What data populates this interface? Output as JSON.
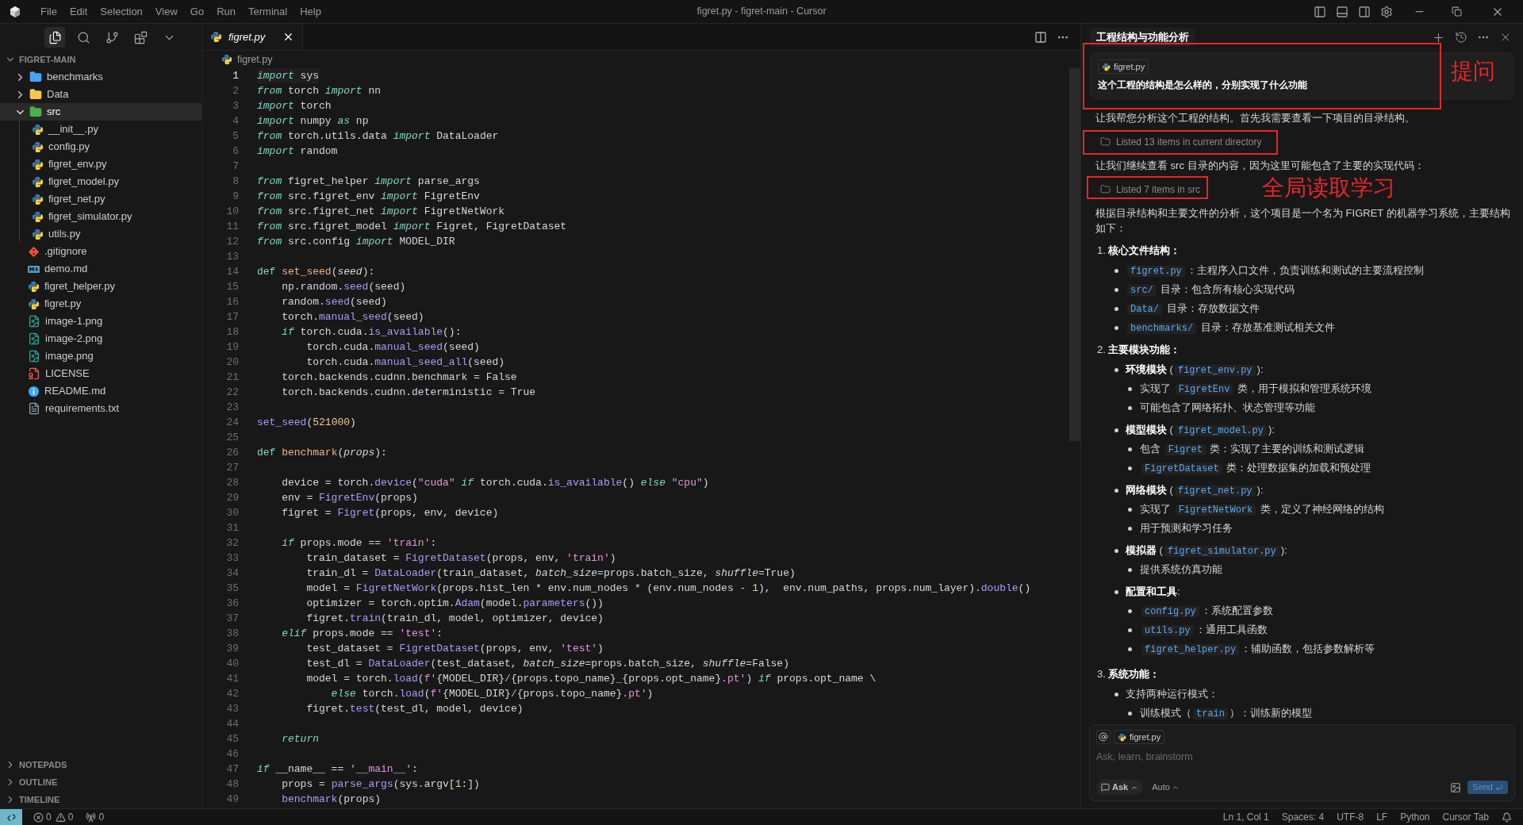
{
  "window": {
    "title": "figret.py - figret-main - Cursor"
  },
  "menu": [
    "File",
    "Edit",
    "Selection",
    "View",
    "Go",
    "Run",
    "Terminal",
    "Help"
  ],
  "activity": [
    {
      "kind": "files",
      "selected": true
    },
    {
      "kind": "search",
      "selected": false
    },
    {
      "kind": "source-control",
      "selected": false
    },
    {
      "kind": "extensions",
      "selected": false
    },
    {
      "kind": "more",
      "selected": false
    }
  ],
  "explorer": {
    "title": "FIGRET-MAIN",
    "expanded": true,
    "items": [
      {
        "name": "benchmarks",
        "kind": "folder-gauge",
        "expanded": false,
        "selected": false
      },
      {
        "name": "Data",
        "kind": "folder-data",
        "expanded": false,
        "selected": false
      },
      {
        "name": "src",
        "kind": "folder-code",
        "expanded": true,
        "selected": true,
        "children": [
          {
            "name": "__init__.py",
            "kind": "python",
            "selected": false
          },
          {
            "name": "config.py",
            "kind": "python",
            "selected": false
          },
          {
            "name": "figret_env.py",
            "kind": "python",
            "selected": false
          },
          {
            "name": "figret_model.py",
            "kind": "python",
            "selected": false
          },
          {
            "name": "figret_net.py",
            "kind": "python",
            "selected": false
          },
          {
            "name": "figret_simulator.py",
            "kind": "python",
            "selected": false
          },
          {
            "name": "utils.py",
            "kind": "python",
            "selected": false
          }
        ]
      },
      {
        "name": ".gitignore",
        "kind": "git",
        "selected": false
      },
      {
        "name": "demo.md",
        "kind": "markdown",
        "selected": false
      },
      {
        "name": "figret_helper.py",
        "kind": "python",
        "selected": false
      },
      {
        "name": "figret.py",
        "kind": "python",
        "selected": false
      },
      {
        "name": "image-1.png",
        "kind": "image",
        "selected": false
      },
      {
        "name": "image-2.png",
        "kind": "image",
        "selected": false
      },
      {
        "name": "image.png",
        "kind": "image",
        "selected": false
      },
      {
        "name": "LICENSE",
        "kind": "license",
        "selected": false
      },
      {
        "name": "README.md",
        "kind": "info",
        "selected": false
      },
      {
        "name": "requirements.txt",
        "kind": "text",
        "selected": false
      }
    ]
  },
  "panels": [
    {
      "title": "NOTEPADS",
      "expanded": false
    },
    {
      "title": "OUTLINE",
      "expanded": false
    },
    {
      "title": "TIMELINE",
      "expanded": false
    }
  ],
  "editor": {
    "tabs": [
      {
        "label": "figret.py",
        "selected": true,
        "preview": true
      }
    ],
    "breadcrumb": "figret.py",
    "lines": [
      {
        "number": "1",
        "current": true,
        "tokens": [
          {
            "kind": "kw",
            "text": "import"
          },
          {
            "kind": "txt",
            "text": " sys"
          }
        ]
      },
      {
        "number": "2",
        "current": false,
        "tokens": [
          {
            "kind": "kw",
            "text": "from"
          },
          {
            "kind": "txt",
            "text": " torch "
          },
          {
            "kind": "kw",
            "text": "import"
          },
          {
            "kind": "txt",
            "text": " nn"
          }
        ]
      },
      {
        "number": "3",
        "current": false,
        "tokens": [
          {
            "kind": "kw",
            "text": "import"
          },
          {
            "kind": "txt",
            "text": " torch"
          }
        ]
      },
      {
        "number": "4",
        "current": false,
        "tokens": [
          {
            "kind": "kw",
            "text": "import"
          },
          {
            "kind": "txt",
            "text": " numpy "
          },
          {
            "kind": "kw",
            "text": "as"
          },
          {
            "kind": "txt",
            "text": " np"
          }
        ]
      },
      {
        "number": "5",
        "current": false,
        "tokens": [
          {
            "kind": "kw",
            "text": "from"
          },
          {
            "kind": "txt",
            "text": " torch.utils.data "
          },
          {
            "kind": "kw",
            "text": "import"
          },
          {
            "kind": "txt",
            "text": " DataLoader"
          }
        ]
      },
      {
        "number": "6",
        "current": false,
        "tokens": [
          {
            "kind": "kw",
            "text": "import"
          },
          {
            "kind": "txt",
            "text": " random"
          }
        ]
      },
      {
        "number": "7",
        "current": false
      },
      {
        "number": "8",
        "current": false,
        "tokens": [
          {
            "kind": "kw",
            "text": "from"
          },
          {
            "kind": "txt",
            "text": " figret_helper "
          },
          {
            "kind": "kw",
            "text": "import"
          },
          {
            "kind": "txt",
            "text": " parse_args"
          }
        ]
      },
      {
        "number": "9",
        "current": false,
        "tokens": [
          {
            "kind": "kw",
            "text": "from"
          },
          {
            "kind": "txt",
            "text": " src.figret_env "
          },
          {
            "kind": "kw",
            "text": "import"
          },
          {
            "kind": "txt",
            "text": " FigretEnv"
          }
        ]
      },
      {
        "number": "10",
        "current": false,
        "tokens": [
          {
            "kind": "kw",
            "text": "from"
          },
          {
            "kind": "txt",
            "text": " src.figret_net "
          },
          {
            "kind": "kw",
            "text": "import"
          },
          {
            "kind": "txt",
            "text": " FigretNetWork"
          }
        ]
      },
      {
        "number": "11",
        "current": false,
        "tokens": [
          {
            "kind": "kw",
            "text": "from"
          },
          {
            "kind": "txt",
            "text": " src.figret_model "
          },
          {
            "kind": "kw",
            "text": "import"
          },
          {
            "kind": "txt",
            "text": " Figret, FigretDataset"
          }
        ]
      },
      {
        "number": "12",
        "current": false,
        "tokens": [
          {
            "kind": "kw",
            "text": "from"
          },
          {
            "kind": "txt",
            "text": " src.config "
          },
          {
            "kind": "kw",
            "text": "import"
          },
          {
            "kind": "txt",
            "text": " MODEL_DIR"
          }
        ]
      },
      {
        "number": "13",
        "current": false
      },
      {
        "number": "14",
        "current": false,
        "tokens": [
          {
            "kind": "def",
            "text": "def "
          },
          {
            "kind": "name",
            "text": "set_seed"
          },
          {
            "kind": "txt",
            "text": "("
          },
          {
            "kind": "param",
            "text": "seed"
          },
          {
            "kind": "txt",
            "text": "):"
          }
        ]
      },
      {
        "number": "15",
        "current": false,
        "tokens": [
          {
            "kind": "txt",
            "text": "    np.random."
          },
          {
            "kind": "fn",
            "text": "seed"
          },
          {
            "kind": "txt",
            "text": "(seed)"
          }
        ]
      },
      {
        "number": "16",
        "current": false,
        "tokens": [
          {
            "kind": "txt",
            "text": "    random."
          },
          {
            "kind": "fn",
            "text": "seed"
          },
          {
            "kind": "txt",
            "text": "(seed)"
          }
        ]
      },
      {
        "number": "17",
        "current": false,
        "tokens": [
          {
            "kind": "txt",
            "text": "    torch."
          },
          {
            "kind": "fn",
            "text": "manual_seed"
          },
          {
            "kind": "txt",
            "text": "(seed)"
          }
        ]
      },
      {
        "number": "18",
        "current": false,
        "tokens": [
          {
            "kind": "kw",
            "text": "    if"
          },
          {
            "kind": "txt",
            "text": " torch.cuda."
          },
          {
            "kind": "fn",
            "text": "is_available"
          },
          {
            "kind": "txt",
            "text": "():"
          }
        ]
      },
      {
        "number": "19",
        "current": false,
        "tokens": [
          {
            "kind": "txt",
            "text": "        torch.cuda."
          },
          {
            "kind": "fn",
            "text": "manual_seed"
          },
          {
            "kind": "txt",
            "text": "(seed)"
          }
        ]
      },
      {
        "number": "20",
        "current": false,
        "tokens": [
          {
            "kind": "txt",
            "text": "        torch.cuda."
          },
          {
            "kind": "fn",
            "text": "manual_seed_all"
          },
          {
            "kind": "txt",
            "text": "(seed)"
          }
        ]
      },
      {
        "number": "21",
        "current": false,
        "tokens": [
          {
            "kind": "txt",
            "text": "    torch.backends.cudnn.benchmark = False"
          }
        ]
      },
      {
        "number": "22",
        "current": false,
        "tokens": [
          {
            "kind": "txt",
            "text": "    torch.backends.cudnn.deterministic = True"
          }
        ]
      },
      {
        "number": "23",
        "current": false
      },
      {
        "number": "24",
        "current": false,
        "tokens": [
          {
            "kind": "fn",
            "text": "set_seed"
          },
          {
            "kind": "txt",
            "text": "("
          },
          {
            "kind": "num",
            "text": "521000"
          },
          {
            "kind": "txt",
            "text": ")"
          }
        ]
      },
      {
        "number": "25",
        "current": false
      },
      {
        "number": "26",
        "current": false,
        "tokens": [
          {
            "kind": "def",
            "text": "def "
          },
          {
            "kind": "name",
            "text": "benchmark"
          },
          {
            "kind": "txt",
            "text": "("
          },
          {
            "kind": "param",
            "text": "props"
          },
          {
            "kind": "txt",
            "text": "):"
          }
        ]
      },
      {
        "number": "27",
        "current": false
      },
      {
        "number": "28",
        "current": false,
        "tokens": [
          {
            "kind": "txt",
            "text": "    device = torch."
          },
          {
            "kind": "fn",
            "text": "device"
          },
          {
            "kind": "txt",
            "text": "("
          },
          {
            "kind": "str",
            "text": "\"cuda\""
          },
          {
            "kind": "kw",
            "text": " if"
          },
          {
            "kind": "txt",
            "text": " torch.cuda."
          },
          {
            "kind": "fn",
            "text": "is_available"
          },
          {
            "kind": "txt",
            "text": "() "
          },
          {
            "kind": "kw",
            "text": "else"
          },
          {
            "kind": "str",
            "text": " \"cpu\""
          },
          {
            "kind": "txt",
            "text": ")"
          }
        ]
      },
      {
        "number": "29",
        "current": false,
        "tokens": [
          {
            "kind": "txt",
            "text": "    env = "
          },
          {
            "kind": "fn",
            "text": "FigretEnv"
          },
          {
            "kind": "txt",
            "text": "(props)"
          }
        ]
      },
      {
        "number": "30",
        "current": false,
        "tokens": [
          {
            "kind": "txt",
            "text": "    figret = "
          },
          {
            "kind": "fn",
            "text": "Figret"
          },
          {
            "kind": "txt",
            "text": "(props, env, device)"
          }
        ]
      },
      {
        "number": "31",
        "current": false
      },
      {
        "number": "32",
        "current": false,
        "tokens": [
          {
            "kind": "kw",
            "text": "    if"
          },
          {
            "kind": "txt",
            "text": " props.mode == "
          },
          {
            "kind": "str",
            "text": "'train'"
          },
          {
            "kind": "txt",
            "text": ":"
          }
        ]
      },
      {
        "number": "33",
        "current": false,
        "tokens": [
          {
            "kind": "txt",
            "text": "        train_dataset = "
          },
          {
            "kind": "fn",
            "text": "FigretDataset"
          },
          {
            "kind": "txt",
            "text": "(props, env, "
          },
          {
            "kind": "str",
            "text": "'train'"
          },
          {
            "kind": "txt",
            "text": ")"
          }
        ]
      },
      {
        "number": "34",
        "current": false,
        "tokens": [
          {
            "kind": "txt",
            "text": "        train_dl = "
          },
          {
            "kind": "fn",
            "text": "DataLoader"
          },
          {
            "kind": "txt",
            "text": "(train_dataset, "
          },
          {
            "kind": "param",
            "text": "batch_size"
          },
          {
            "kind": "txt",
            "text": "=props.batch_size, "
          },
          {
            "kind": "param",
            "text": "shuffle"
          },
          {
            "kind": "txt",
            "text": "=True)"
          }
        ]
      },
      {
        "number": "35",
        "current": false,
        "tokens": [
          {
            "kind": "txt",
            "text": "        model = "
          },
          {
            "kind": "fn",
            "text": "FigretNetWork"
          },
          {
            "kind": "txt",
            "text": "(props.hist_len * env.num_nodes * (env.num_nodes - "
          },
          {
            "kind": "num",
            "text": "1"
          },
          {
            "kind": "txt",
            "text": "),  env.num_paths, props.num_layer)."
          },
          {
            "kind": "fn",
            "text": "double"
          },
          {
            "kind": "txt",
            "text": "()"
          }
        ]
      },
      {
        "number": "36",
        "current": false,
        "tokens": [
          {
            "kind": "txt",
            "text": "        optimizer = torch.optim."
          },
          {
            "kind": "fn",
            "text": "Adam"
          },
          {
            "kind": "txt",
            "text": "(model."
          },
          {
            "kind": "fn",
            "text": "parameters"
          },
          {
            "kind": "txt",
            "text": "())"
          }
        ]
      },
      {
        "number": "37",
        "current": false,
        "tokens": [
          {
            "kind": "txt",
            "text": "        figret."
          },
          {
            "kind": "fn",
            "text": "train"
          },
          {
            "kind": "txt",
            "text": "(train_dl, model, optimizer, device)"
          }
        ]
      },
      {
        "number": "38",
        "current": false,
        "tokens": [
          {
            "kind": "kw",
            "text": "    elif"
          },
          {
            "kind": "txt",
            "text": " props.mode == "
          },
          {
            "kind": "str",
            "text": "'test'"
          },
          {
            "kind": "txt",
            "text": ":"
          }
        ]
      },
      {
        "number": "39",
        "current": false,
        "tokens": [
          {
            "kind": "txt",
            "text": "        test_dataset = "
          },
          {
            "kind": "fn",
            "text": "FigretDataset"
          },
          {
            "kind": "txt",
            "text": "(props, env, "
          },
          {
            "kind": "str",
            "text": "'test'"
          },
          {
            "kind": "txt",
            "text": ")"
          }
        ]
      },
      {
        "number": "40",
        "current": false,
        "tokens": [
          {
            "kind": "txt",
            "text": "        test_dl = "
          },
          {
            "kind": "fn",
            "text": "DataLoader"
          },
          {
            "kind": "txt",
            "text": "(test_dataset, "
          },
          {
            "kind": "param",
            "text": "batch_size"
          },
          {
            "kind": "txt",
            "text": "=props.batch_size, "
          },
          {
            "kind": "param",
            "text": "shuffle"
          },
          {
            "kind": "txt",
            "text": "=False)"
          }
        ]
      },
      {
        "number": "41",
        "current": false,
        "tokens": [
          {
            "kind": "txt",
            "text": "        model = torch."
          },
          {
            "kind": "fn",
            "text": "load"
          },
          {
            "kind": "txt",
            "text": "("
          },
          {
            "kind": "str",
            "text": "f'"
          },
          {
            "kind": "txt",
            "text": "{MODEL_DIR}"
          },
          {
            "kind": "str",
            "text": "/"
          },
          {
            "kind": "txt",
            "text": "{props.topo_name}"
          },
          {
            "kind": "str",
            "text": "_"
          },
          {
            "kind": "txt",
            "text": "{props.opt_name}"
          },
          {
            "kind": "str",
            "text": ".pt'"
          },
          {
            "kind": "txt",
            "text": ") "
          },
          {
            "kind": "kw",
            "text": "if"
          },
          {
            "kind": "txt",
            "text": " props.opt_name \\"
          }
        ]
      },
      {
        "number": "42",
        "current": false,
        "tokens": [
          {
            "kind": "kw",
            "text": "            else"
          },
          {
            "kind": "txt",
            "text": " torch."
          },
          {
            "kind": "fn",
            "text": "load"
          },
          {
            "kind": "txt",
            "text": "("
          },
          {
            "kind": "str",
            "text": "f'"
          },
          {
            "kind": "txt",
            "text": "{MODEL_DIR}"
          },
          {
            "kind": "str",
            "text": "/"
          },
          {
            "kind": "txt",
            "text": "{props.topo_name}"
          },
          {
            "kind": "str",
            "text": ".pt'"
          },
          {
            "kind": "txt",
            "text": ")"
          }
        ]
      },
      {
        "number": "43",
        "current": false,
        "tokens": [
          {
            "kind": "txt",
            "text": "        figret."
          },
          {
            "kind": "fn",
            "text": "test"
          },
          {
            "kind": "txt",
            "text": "(test_dl, model, device)"
          }
        ]
      },
      {
        "number": "44",
        "current": false
      },
      {
        "number": "45",
        "current": false,
        "tokens": [
          {
            "kind": "kw",
            "text": "    return"
          }
        ]
      },
      {
        "number": "46",
        "current": false
      },
      {
        "number": "47",
        "current": false,
        "tokens": [
          {
            "kind": "kw",
            "text": "if"
          },
          {
            "kind": "txt",
            "text": " __name__ == "
          },
          {
            "kind": "str",
            "text": "'__main__'"
          },
          {
            "kind": "txt",
            "text": ":"
          }
        ]
      },
      {
        "number": "48",
        "current": false,
        "tokens": [
          {
            "kind": "txt",
            "text": "    props = "
          },
          {
            "kind": "fn",
            "text": "parse_args"
          },
          {
            "kind": "txt",
            "text": "(sys.argv["
          },
          {
            "kind": "num",
            "text": "1"
          },
          {
            "kind": "txt",
            "text": ":])"
          }
        ]
      },
      {
        "number": "49",
        "current": false,
        "tokens": [
          {
            "kind": "fn",
            "text": "    benchmark"
          },
          {
            "kind": "txt",
            "text": "(props)"
          }
        ]
      }
    ]
  },
  "chat": {
    "tabs": [
      {
        "label": "工程结构与功能分析",
        "selected": true
      }
    ],
    "user_message": {
      "chip": "figret.py",
      "text": "这个工程的结构是怎么样的，分别实现了什么功能"
    },
    "blocks": [
      {
        "kind": "paragraph",
        "text": "让我帮您分析这个工程的结构。首先我需要查看一下项目的目录结构。"
      },
      {
        "kind": "tool",
        "text": "Listed 13 items in current directory"
      },
      {
        "kind": "paragraph",
        "text": "让我们继续查看 src 目录的内容，因为这里可能包含了主要的实现代码："
      },
      {
        "kind": "tool",
        "text": "Listed 7 items in src"
      },
      {
        "kind": "paragraph",
        "text": "根据目录结构和主要文件的分析，这个项目是一个名为 FIGRET 的机器学习系统，主要结构如下："
      },
      {
        "kind": "ordered",
        "items": [
          {
            "number": "1.",
            "title": "核心文件结构：",
            "bullets": [
              {
                "segments": [
                  {
                    "kind": "code",
                    "text": "figret.py"
                  },
                  {
                    "kind": "text",
                    "text": "：主程序入口文件，负责训练和测试的主要流程控制"
                  }
                ]
              },
              {
                "segments": [
                  {
                    "kind": "code",
                    "text": "src/"
                  },
                  {
                    "kind": "text",
                    "text": " 目录：包含所有核心实现代码"
                  }
                ]
              },
              {
                "segments": [
                  {
                    "kind": "code",
                    "text": "Data/"
                  },
                  {
                    "kind": "text",
                    "text": " 目录：存放数据文件"
                  }
                ]
              },
              {
                "segments": [
                  {
                    "kind": "code",
                    "text": "benchmarks/"
                  },
                  {
                    "kind": "text",
                    "text": " 目录：存放基准测试相关文件"
                  }
                ]
              }
            ]
          },
          {
            "number": "2.",
            "title": "主要模块功能：",
            "bullets": [
              {
                "segments": [
                  {
                    "kind": "bold",
                    "text": "环境模块"
                  },
                  {
                    "kind": "text",
                    "text": " ("
                  },
                  {
                    "kind": "code",
                    "text": "figret_env.py"
                  },
                  {
                    "kind": "text",
                    "text": "):"
                  }
                ],
                "children": [
                  {
                    "segments": [
                      {
                        "kind": "text",
                        "text": "实现了 "
                      },
                      {
                        "kind": "code",
                        "text": "FigretEnv"
                      },
                      {
                        "kind": "text",
                        "text": " 类，用于模拟和管理系统环境"
                      }
                    ]
                  },
                  {
                    "segments": [
                      {
                        "kind": "text",
                        "text": "可能包含了网络拓扑、状态管理等功能"
                      }
                    ]
                  }
                ]
              },
              {
                "segments": [
                  {
                    "kind": "bold",
                    "text": "模型模块"
                  },
                  {
                    "kind": "text",
                    "text": " ("
                  },
                  {
                    "kind": "code",
                    "text": "figret_model.py"
                  },
                  {
                    "kind": "text",
                    "text": "):"
                  }
                ],
                "children": [
                  {
                    "segments": [
                      {
                        "kind": "text",
                        "text": "包含 "
                      },
                      {
                        "kind": "code",
                        "text": "Figret"
                      },
                      {
                        "kind": "text",
                        "text": " 类：实现了主要的训练和测试逻辑"
                      }
                    ]
                  },
                  {
                    "segments": [
                      {
                        "kind": "code",
                        "text": "FigretDataset"
                      },
                      {
                        "kind": "text",
                        "text": " 类：处理数据集的加载和预处理"
                      }
                    ]
                  }
                ]
              },
              {
                "segments": [
                  {
                    "kind": "bold",
                    "text": "网络模块"
                  },
                  {
                    "kind": "text",
                    "text": " ("
                  },
                  {
                    "kind": "code",
                    "text": "figret_net.py"
                  },
                  {
                    "kind": "text",
                    "text": "):"
                  }
                ],
                "children": [
                  {
                    "segments": [
                      {
                        "kind": "text",
                        "text": "实现了 "
                      },
                      {
                        "kind": "code",
                        "text": "FigretNetWork"
                      },
                      {
                        "kind": "text",
                        "text": " 类，定义了神经网络的结构"
                      }
                    ]
                  },
                  {
                    "segments": [
                      {
                        "kind": "text",
                        "text": "用于预测和学习任务"
                      }
                    ]
                  }
                ]
              },
              {
                "segments": [
                  {
                    "kind": "bold",
                    "text": "模拟器"
                  },
                  {
                    "kind": "text",
                    "text": " ("
                  },
                  {
                    "kind": "code",
                    "text": "figret_simulator.py"
                  },
                  {
                    "kind": "text",
                    "text": "):"
                  }
                ],
                "children": [
                  {
                    "segments": [
                      {
                        "kind": "text",
                        "text": "提供系统仿真功能"
                      }
                    ]
                  }
                ]
              },
              {
                "segments": [
                  {
                    "kind": "bold",
                    "text": "配置和工具"
                  },
                  {
                    "kind": "text",
                    "text": ":"
                  }
                ],
                "children": [
                  {
                    "segments": [
                      {
                        "kind": "code",
                        "text": "config.py"
                      },
                      {
                        "kind": "text",
                        "text": "：系统配置参数"
                      }
                    ]
                  },
                  {
                    "segments": [
                      {
                        "kind": "code",
                        "text": "utils.py"
                      },
                      {
                        "kind": "text",
                        "text": "：通用工具函数"
                      }
                    ]
                  },
                  {
                    "segments": [
                      {
                        "kind": "code",
                        "text": "figret_helper.py"
                      },
                      {
                        "kind": "text",
                        "text": "：辅助函数，包括参数解析等"
                      }
                    ]
                  }
                ]
              }
            ]
          },
          {
            "number": "3.",
            "title": "系统功能：",
            "bullets": [
              {
                "segments": [
                  {
                    "kind": "text",
                    "text": "支持两种运行模式："
                  }
                ],
                "children": [
                  {
                    "segments": [
                      {
                        "kind": "text",
                        "text": "训练模式（"
                      },
                      {
                        "kind": "code",
                        "text": "train"
                      },
                      {
                        "kind": "text",
                        "text": "）：训练新的模型"
                      }
                    ]
                  }
                ]
              }
            ]
          }
        ]
      }
    ],
    "input": {
      "chip": "figret.py",
      "placeholder": "Ask, learn, brainstorm",
      "mode": "Ask",
      "model": "Auto",
      "send": "Send"
    }
  },
  "annotations": [
    {
      "kind": "box"
    },
    {
      "kind": "label",
      "text": "提问"
    },
    {
      "kind": "box"
    },
    {
      "kind": "box"
    },
    {
      "kind": "label",
      "text": "全局读取学习"
    }
  ],
  "status_bar": {
    "errors": "0",
    "warnings": "0",
    "ports": "0",
    "items": [
      "Ln 1, Col 1",
      "Spaces: 4",
      "UTF-8",
      "LF",
      "Python",
      "Cursor Tab"
    ]
  }
}
